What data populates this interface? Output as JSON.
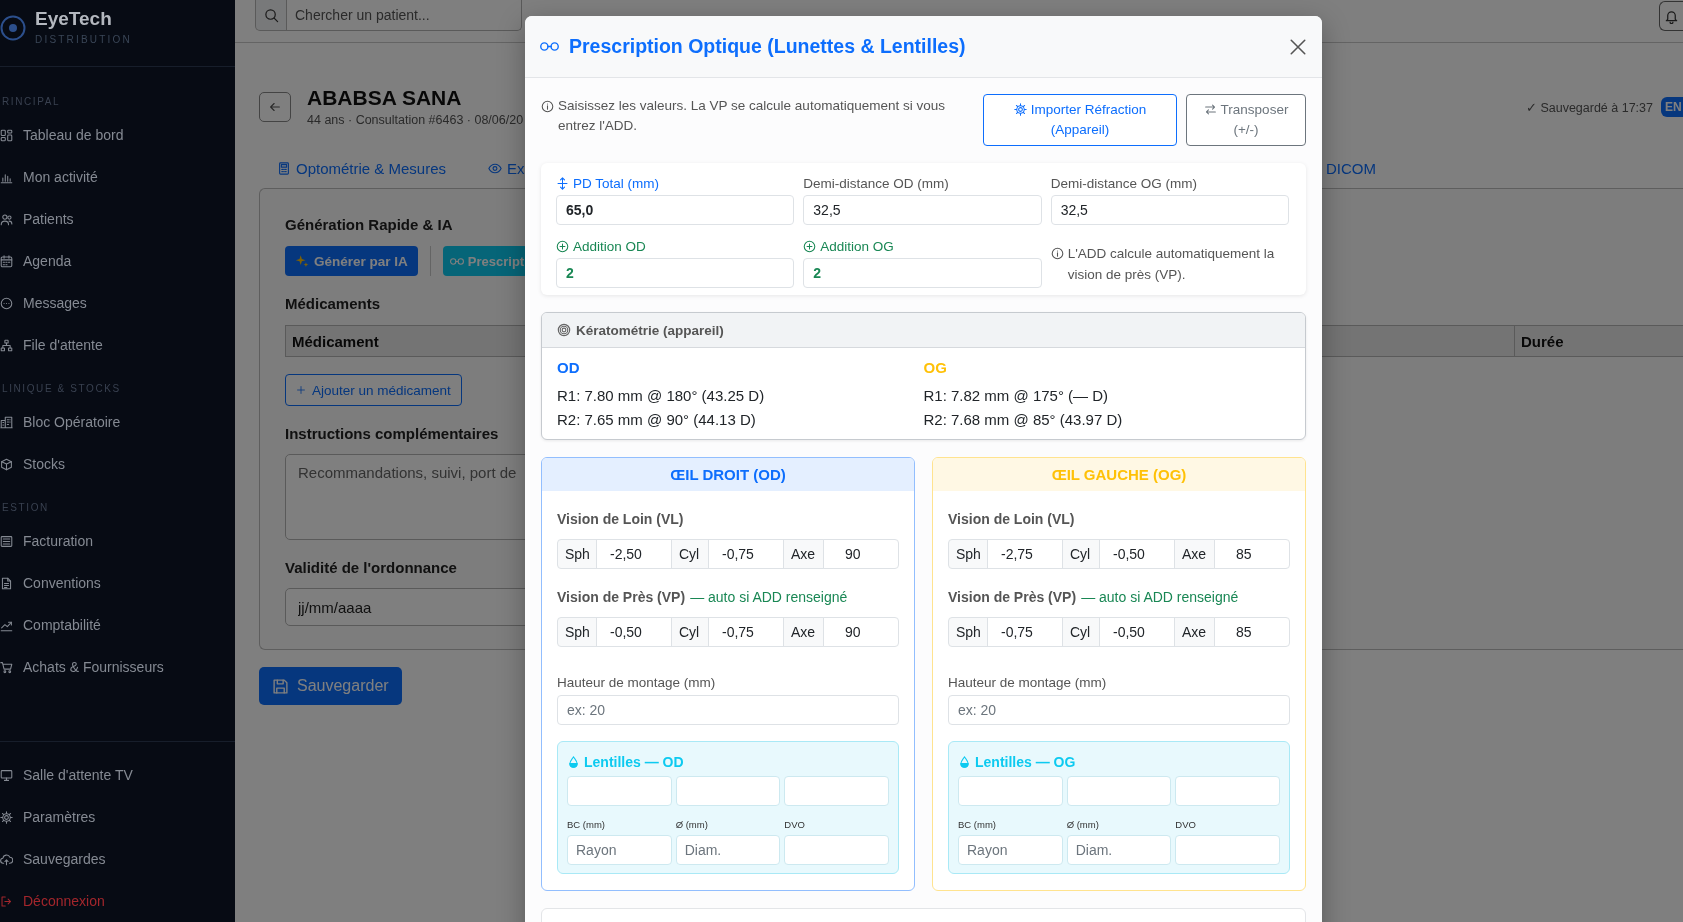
{
  "sidebar": {
    "brand": {
      "name": "EyeTech",
      "tagline": "DISTRIBUTION"
    },
    "sections": [
      {
        "heading": "RINCIPAL",
        "items": [
          {
            "label": "Tableau de bord",
            "selected": false
          },
          {
            "label": "Mon activité",
            "selected": false
          },
          {
            "label": "Patients",
            "selected": false
          },
          {
            "label": "Agenda",
            "selected": false
          },
          {
            "label": "Messages",
            "selected": false
          },
          {
            "label": "File d'attente",
            "selected": false
          }
        ]
      },
      {
        "heading": "LINIQUE & STOCKS",
        "items": [
          {
            "label": "Bloc Opératoire",
            "selected": false
          },
          {
            "label": "Stocks",
            "selected": false
          }
        ]
      },
      {
        "heading": "ESTION",
        "items": [
          {
            "label": "Facturation",
            "selected": false
          },
          {
            "label": "Conventions",
            "selected": false
          },
          {
            "label": "Comptabilité",
            "selected": false
          },
          {
            "label": "Achats & Fournisseurs",
            "selected": false
          }
        ]
      }
    ],
    "footer_items": [
      {
        "label": "Salle d'attente TV",
        "selected": false,
        "danger": false
      },
      {
        "label": "Paramètres",
        "selected": false,
        "danger": false
      },
      {
        "label": "Sauvegardes",
        "selected": false,
        "danger": false
      },
      {
        "label": "Déconnexion",
        "selected": false,
        "danger": true
      }
    ]
  },
  "topbar": {
    "search": {
      "placeholder": "Chercher un patient..."
    }
  },
  "patient": {
    "name": "ABABSA SANA",
    "details": "44 ans · Consultation #6463 · 08/06/20",
    "save_status": "✓ Sauvegardé à 17:37",
    "language": "EN"
  },
  "tabs": [
    {
      "label": "Optométrie & Mesures",
      "selected": false
    },
    {
      "label": "Ex",
      "selected": false
    },
    {
      "label": "DICOM",
      "selected": false
    }
  ],
  "prescription_panel": {
    "generation": {
      "title": "Génération Rapide & IA",
      "buttons": [
        {
          "label": "Générer par IA",
          "kind": "ai"
        },
        {
          "label": "Prescript",
          "kind": "optical"
        }
      ]
    },
    "medications": {
      "title": "Médicaments",
      "columns": [
        "Médicament",
        "Durée"
      ],
      "add_button": "Ajouter un médicament"
    },
    "instructions": {
      "label": "Instructions complémentaires",
      "placeholder": "Recommandations, suivi, port de"
    },
    "validity": {
      "label": "Validité de l'ordonnance",
      "placeholder": "jj/mm/aaaa"
    }
  },
  "save_button": "Sauvegarder",
  "modal": {
    "title": "Prescription Optique (Lunettes & Lentilles)",
    "info": "Saisissez les valeurs. La VP se calcule automatiquement si vous entrez l'ADD.",
    "actions": [
      {
        "label": "Importer Réfraction (Appareil)",
        "kind": "import"
      },
      {
        "label": "Transposer (+/-)",
        "kind": "transpose"
      }
    ],
    "measurements": {
      "fields": [
        {
          "label": "PD Total (mm)",
          "value": "65,0",
          "kind": "pd"
        },
        {
          "label": "Demi-distance OD (mm)",
          "value": "32,5",
          "kind": "plain"
        },
        {
          "label": "Demi-distance OG (mm)",
          "value": "32,5",
          "kind": "plain"
        },
        {
          "label": "Addition OD",
          "value": "2",
          "kind": "addition"
        },
        {
          "label": "Addition OG",
          "value": "2",
          "kind": "addition"
        }
      ],
      "note": "L'ADD calcule automatiquement la vision de près (VP)."
    },
    "keratometry": {
      "title": "Kératométrie (appareil)",
      "eyes": [
        {
          "name": "OD",
          "color": "#0d6efd",
          "readings": [
            "R1: 7.80 mm @ 180° (43.25 D)",
            "R2: 7.65 mm @ 90° (44.13 D)"
          ]
        },
        {
          "name": "OG",
          "color": "#ffc107",
          "readings": [
            "R1: 7.82 mm @ 175° (— D)",
            "R2: 7.68 mm @ 85° (43.97 D)"
          ]
        }
      ]
    },
    "eyes": [
      {
        "title": "ŒIL DROIT (OD)",
        "color": "#0d6efd",
        "distance": {
          "title": "Vision de Loin (VL)",
          "cells": [
            {
              "label": "Sph",
              "value": "-2,50"
            },
            {
              "label": "Cyl",
              "value": "-0,75"
            },
            {
              "label": "Axe",
              "value": "90"
            }
          ]
        },
        "near": {
          "title": "Vision de Près (VP)",
          "note": "— auto si ADD renseigné",
          "cells": [
            {
              "label": "Sph",
              "value": "-0,50"
            },
            {
              "label": "Cyl",
              "value": "-0,75"
            },
            {
              "label": "Axe",
              "value": "90"
            }
          ]
        },
        "mounting_height": {
          "label": "Hauteur de montage (mm)",
          "placeholder": "ex: 20"
        },
        "lenses": {
          "title": "Lentilles — OD",
          "fields": [
            {
              "label": "BC (mm)",
              "placeholder": "Rayon"
            },
            {
              "label": "Ø (mm)",
              "placeholder": "Diam."
            },
            {
              "label": "DVO"
            }
          ]
        }
      },
      {
        "title": "ŒIL GAUCHE (OG)",
        "color": "#ffc107",
        "distance": {
          "title": "Vision de Loin (VL)",
          "cells": [
            {
              "label": "Sph",
              "value": "-2,75"
            },
            {
              "label": "Cyl",
              "value": "-0,50"
            },
            {
              "label": "Axe",
              "value": "85"
            }
          ]
        },
        "near": {
          "title": "Vision de Près (VP)",
          "note": "— auto si ADD renseigné",
          "cells": [
            {
              "label": "Sph",
              "value": "-0,75"
            },
            {
              "label": "Cyl",
              "value": "-0,50"
            },
            {
              "label": "Axe",
              "value": "85"
            }
          ]
        },
        "mounting_height": {
          "label": "Hauteur de montage (mm)",
          "placeholder": "ex: 20"
        },
        "lenses": {
          "title": "Lentilles — OG",
          "fields": [
            {
              "label": "BC (mm)",
              "placeholder": "Rayon"
            },
            {
              "label": "Ø (mm)",
              "placeholder": "Diam."
            },
            {
              "label": "DVO"
            }
          ]
        }
      }
    ]
  }
}
